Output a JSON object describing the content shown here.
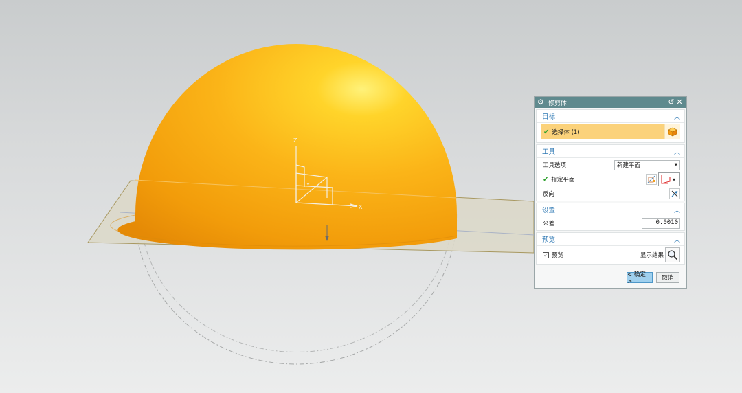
{
  "viewport": {
    "colors": {
      "solid": "#f5a810",
      "plane": "#dcd8c8",
      "plane_border": "#a89860"
    },
    "triad": {
      "x": "X",
      "y": "Y",
      "z": "Z"
    }
  },
  "dialog": {
    "title": "修剪体",
    "title_icon": "gear-icon",
    "reset_icon": "reset-icon",
    "close_icon": "close-icon",
    "target": {
      "header": "目标",
      "select_label": "选择体 (1)",
      "select_icon": "solid-body-cube-icon"
    },
    "tool": {
      "header": "工具",
      "tool_option_label": "工具选项",
      "tool_option_value": "新建平面",
      "specify_plane_label": "指定平面",
      "reverse_label": "反向"
    },
    "settings": {
      "header": "设置",
      "tolerance_label": "公差",
      "tolerance_value": "0.0010"
    },
    "preview": {
      "header": "预览",
      "preview_label": "预览",
      "preview_checked": true,
      "show_result_label": "显示结果"
    },
    "ok_label": "< 确定 >",
    "cancel_label": "取消",
    "accent": "#2f79b4",
    "select_highlight": "#fbd27b"
  }
}
